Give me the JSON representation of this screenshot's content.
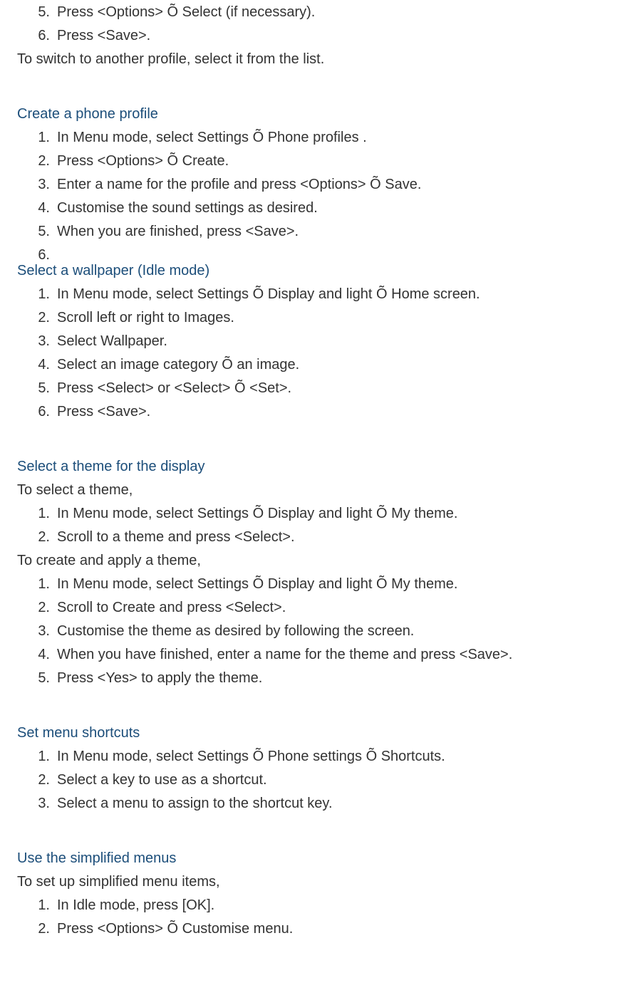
{
  "intro_list": [
    {
      "num": "5.",
      "text": "Press <Options> Õ Select (if necessary)."
    },
    {
      "num": "6.",
      "text": "Press <Save>."
    }
  ],
  "intro_para": "To switch to another profile, select it from the list.",
  "sections": [
    {
      "heading": "Create a phone profile",
      "blocks": [
        {
          "type": "list",
          "items": [
            {
              "num": "1.",
              "text": "In Menu mode, select Settings Õ Phone profiles ."
            },
            {
              "num": "2.",
              "text": "Press <Options> Õ Create."
            },
            {
              "num": "3.",
              "text": "Enter a name for the profile and press <Options> Õ Save."
            },
            {
              "num": "4.",
              "text": "Customise the sound settings as desired."
            },
            {
              "num": "5.",
              "text": "When you are finished, press <Save>."
            },
            {
              "num": "6.",
              "text": ""
            }
          ]
        }
      ],
      "no_bottom_spacer": true
    },
    {
      "heading": "Select a wallpaper (Idle mode)",
      "blocks": [
        {
          "type": "list",
          "items": [
            {
              "num": "1.",
              "text": "In Menu mode, select Settings Õ Display and light Õ Home screen."
            },
            {
              "num": "2.",
              "text": "Scroll left or right to Images."
            },
            {
              "num": "3.",
              "text": "Select Wallpaper."
            },
            {
              "num": "4.",
              "text": "Select an image category Õ an image."
            },
            {
              "num": "5.",
              "text": "Press <Select> or <Select> Õ <Set>."
            },
            {
              "num": "6.",
              "text": "Press <Save>."
            }
          ]
        }
      ]
    },
    {
      "heading": "Select a theme for the display",
      "blocks": [
        {
          "type": "para",
          "text": "To select a theme,"
        },
        {
          "type": "list",
          "items": [
            {
              "num": "1.",
              "text": "In Menu mode, select Settings Õ Display and light Õ My theme."
            },
            {
              "num": "2.",
              "text": "Scroll to a theme and press <Select>."
            }
          ]
        },
        {
          "type": "para",
          "text": "To create and apply a theme,"
        },
        {
          "type": "list",
          "items": [
            {
              "num": "1.",
              "text": "In Menu mode, select Settings Õ Display and light Õ My theme."
            },
            {
              "num": "2.",
              "text": "Scroll to Create and press <Select>."
            },
            {
              "num": "3.",
              "text": "Customise the theme as desired by following the screen."
            },
            {
              "num": "4.",
              "text": "When you have finished, enter a name for the theme and press <Save>."
            },
            {
              "num": "5.",
              "text": "Press <Yes> to apply the theme."
            }
          ]
        }
      ]
    },
    {
      "heading": "Set menu shortcuts",
      "blocks": [
        {
          "type": "list",
          "items": [
            {
              "num": "1.",
              "text": "In Menu mode, select Settings Õ Phone settings Õ Shortcuts."
            },
            {
              "num": "2.",
              "text": "Select a key to use as a shortcut."
            },
            {
              "num": "3.",
              "text": "Select a menu to assign to the shortcut key."
            }
          ]
        }
      ]
    },
    {
      "heading": "Use the simplified menus",
      "blocks": [
        {
          "type": "para",
          "text": "To set up simplified menu items,"
        },
        {
          "type": "list",
          "items": [
            {
              "num": "1.",
              "text": "In Idle mode, press [OK]."
            },
            {
              "num": "2.",
              "text": "Press <Options> Õ Customise menu."
            }
          ]
        }
      ],
      "no_bottom_spacer": true
    }
  ]
}
